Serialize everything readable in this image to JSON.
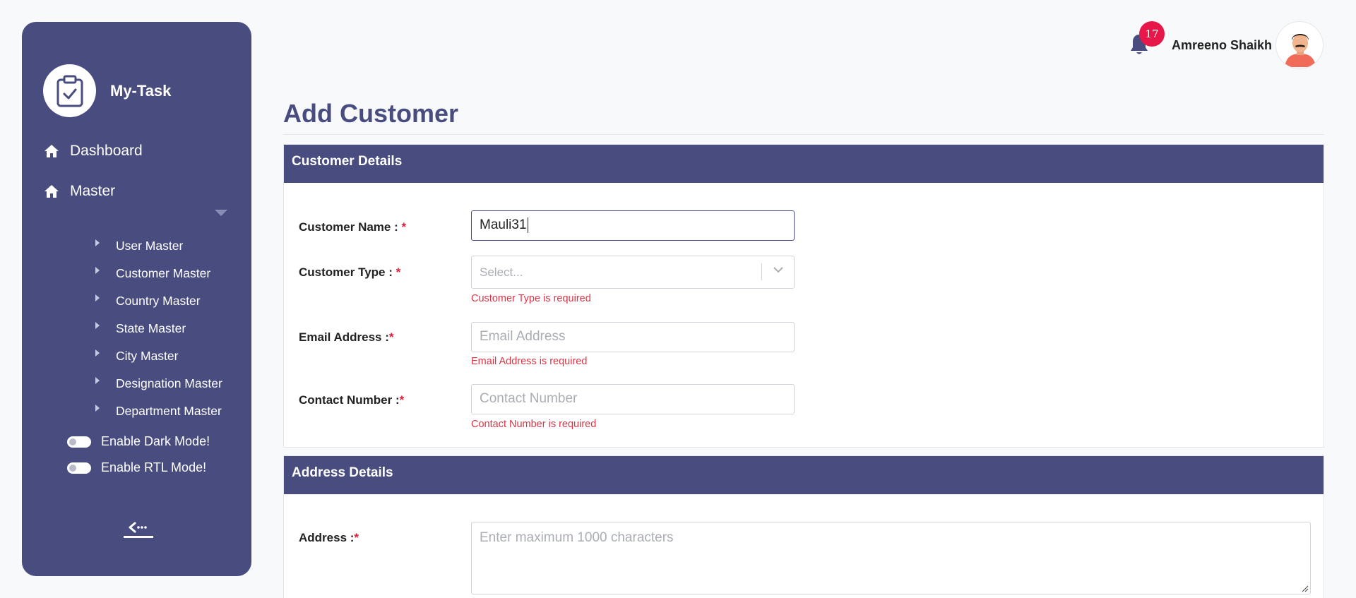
{
  "app": {
    "name": "My-Task"
  },
  "sidebar": {
    "nav": [
      {
        "label": "Dashboard",
        "icon": "home-icon"
      },
      {
        "label": "Master",
        "icon": "home-icon"
      }
    ],
    "sub_items": [
      "User Master",
      "Customer Master",
      "Country Master",
      "State Master",
      "City Master",
      "Designation Master",
      "Department Master"
    ],
    "toggles": {
      "dark_mode": "Enable Dark Mode!",
      "rtl_mode": "Enable RTL Mode!"
    }
  },
  "header": {
    "notification_count": "17",
    "user_name": "Amreeno Shaikh"
  },
  "page": {
    "title": "Add Customer"
  },
  "customer_details": {
    "heading": "Customer Details",
    "name_label": "Customer Name : ",
    "name_value": "Mauli31",
    "type_label": "Customer Type : ",
    "type_placeholder": "Select...",
    "type_error": "Customer Type is required",
    "email_label": "Email Address :",
    "email_placeholder": "Email Address",
    "email_error": "Email Address is required",
    "contact_label": "Contact Number :",
    "contact_placeholder": "Contact Number",
    "contact_error": "Contact Number is required",
    "required_mark": "*"
  },
  "address_details": {
    "heading": "Address Details",
    "address_label": "Address :",
    "address_placeholder": "Enter maximum 1000 characters",
    "required_mark": "*"
  },
  "colors": {
    "primary": "#484c7f",
    "error": "#dc3545",
    "badge": "#e8174a"
  }
}
